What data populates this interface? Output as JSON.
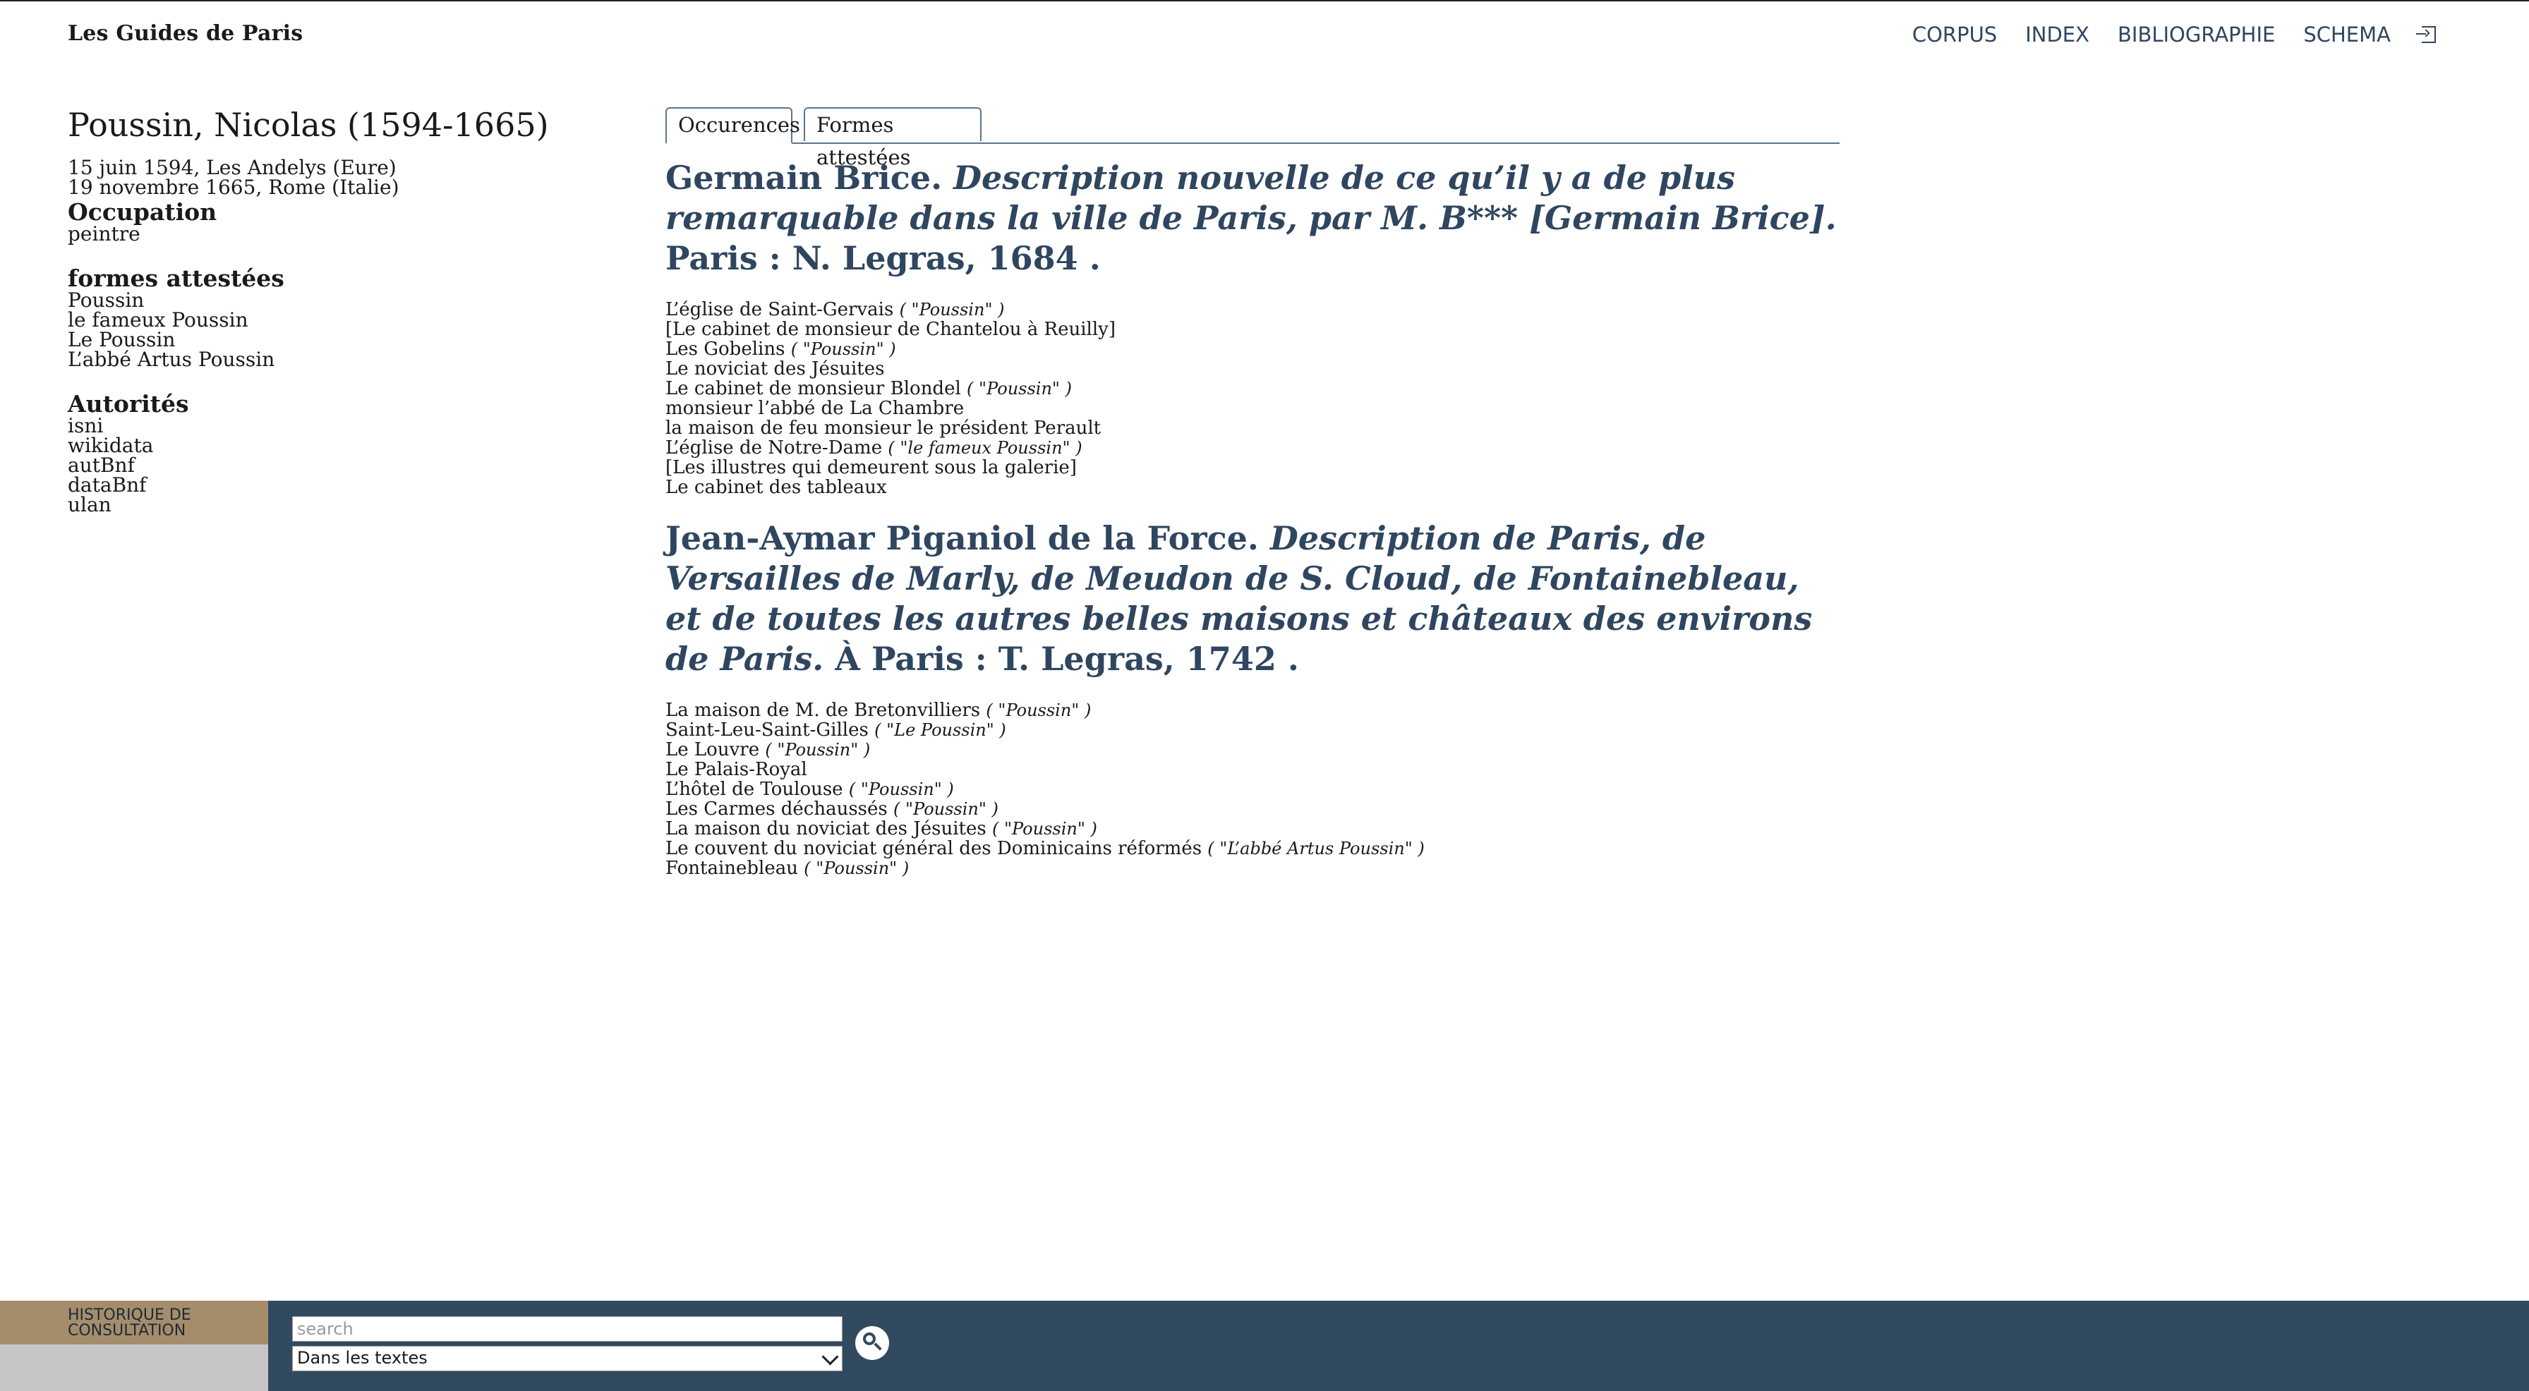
{
  "header": {
    "brand": "Les Guides de Paris",
    "nav": [
      "CORPUS",
      "INDEX",
      "BIBLIOGRAPHIE",
      "SCHEMA"
    ],
    "login_icon": "login-icon"
  },
  "person": {
    "name": "Poussin, Nicolas (1594-1665)",
    "birth": "15 juin 1594, Les Andelys (Eure)",
    "death": "19 novembre 1665, Rome (Italie)",
    "occupation_title": "Occupation",
    "occupation": "peintre",
    "forms_title": "formes attestées",
    "forms": [
      "Poussin",
      "le fameux Poussin",
      "Le Poussin",
      "L’abbé Artus Poussin"
    ],
    "authorities_title": "Autorités",
    "authorities": [
      "isni",
      "wikidata",
      "autBnf",
      "dataBnf",
      "ulan"
    ]
  },
  "tabs": [
    "Occurences",
    "Formes attestées"
  ],
  "works": [
    {
      "author": "Germain Brice.",
      "title": "Description nouvelle de ce qu’il y a de plus remarquable dans la ville de Paris, par M. B*** [Germain Brice].",
      "imprint": "Paris : N. Legras, 1684 .",
      "occurrences": [
        {
          "place": "L’église de Saint-Gervais",
          "form": "( \"Poussin\" )"
        },
        {
          "place": "[Le cabinet de monsieur de Chantelou à Reuilly]",
          "form": ""
        },
        {
          "place": "Les Gobelins",
          "form": "( \"Poussin\" )"
        },
        {
          "place": "Le noviciat des Jésuites",
          "form": ""
        },
        {
          "place": "Le cabinet de monsieur Blondel",
          "form": "( \"Poussin\" )"
        },
        {
          "place": "monsieur l’abbé de La Chambre",
          "form": ""
        },
        {
          "place": "la maison de feu monsieur le président Perault",
          "form": ""
        },
        {
          "place": "L’église de Notre-Dame",
          "form": "( \"le fameux Poussin\" )"
        },
        {
          "place": "[Les illustres qui demeurent sous la galerie]",
          "form": ""
        },
        {
          "place": "Le cabinet des tableaux",
          "form": ""
        }
      ]
    },
    {
      "author": "Jean-Aymar Piganiol de la Force.",
      "title": "Description de Paris, de Versailles de Marly, de Meudon de S. Cloud, de Fontainebleau, et de toutes les autres belles maisons et châteaux des environs de Paris.",
      "imprint": "À Paris : T. Legras, 1742 .",
      "occurrences": [
        {
          "place": "La maison de M. de Bretonvilliers",
          "form": "( \"Poussin\" )"
        },
        {
          "place": "Saint-Leu-Saint-Gilles",
          "form": "( \"Le Poussin\" )"
        },
        {
          "place": "Le Louvre",
          "form": "( \"Poussin\" )"
        },
        {
          "place": "Le Palais-Royal",
          "form": ""
        },
        {
          "place": "L’hôtel de Toulouse",
          "form": "( \"Poussin\" )"
        },
        {
          "place": "Les Carmes déchaussés",
          "form": "( \"Poussin\" )"
        },
        {
          "place": "La maison du noviciat des Jésuites",
          "form": "( \"Poussin\" )"
        },
        {
          "place": "Le couvent du noviciat général des Dominicains réformés",
          "form": "( \"L’abbé Artus Poussin\" )"
        },
        {
          "place": "Fontainebleau",
          "form": "( \"Poussin\" )"
        }
      ]
    }
  ],
  "footer": {
    "history_label": "HISTORIQUE DE CONSULTATION",
    "search_placeholder": "search",
    "scope_value": "Dans les textes",
    "search_icon": "search-icon"
  }
}
